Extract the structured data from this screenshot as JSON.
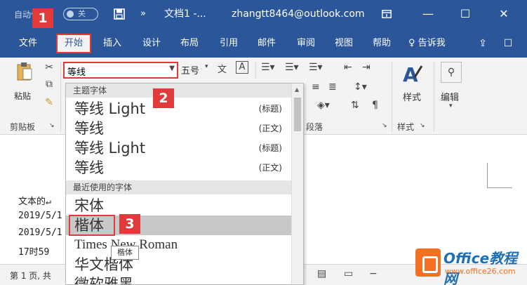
{
  "titlebar": {
    "autosave_label": "自动保存",
    "toggle_label": "关",
    "save_icon": "save-icon",
    "more_glyph": "»",
    "doc_title": "文档1 -...",
    "account": "zhangtt8464@outlook.com",
    "display_icon": "ribbon-display-icon",
    "min_glyph": "—",
    "max_glyph": "☐",
    "close_glyph": "✕"
  },
  "tabs": [
    "文件",
    "开始",
    "插入",
    "设计",
    "布局",
    "引用",
    "邮件",
    "审阅",
    "视图",
    "帮助"
  ],
  "active_tab": "开始",
  "tell_me": "告诉我",
  "ribbon": {
    "paste_label": "粘贴",
    "clipboard_label": "剪贴板",
    "font_name": "等线",
    "font_size": "五号",
    "paragraph_label": "段落",
    "styles_label": "样式",
    "styles_group_label": "样式",
    "edit_label": "编辑"
  },
  "font_dropdown": {
    "theme_header": "主题字体",
    "theme_fonts": [
      {
        "name": "等线 Light",
        "tag": "(标题)"
      },
      {
        "name": "等线",
        "tag": "(正文)"
      },
      {
        "name": "等线 Light",
        "tag": "(标题)"
      },
      {
        "name": "等线",
        "tag": "(正文)"
      }
    ],
    "recent_header": "最近使用的字体",
    "recent_fonts": [
      "宋体",
      "楷体",
      "Times New Roman",
      "华文楷体",
      "微软雅黑"
    ],
    "hovered_font": "楷体"
  },
  "tooltip": "楷体",
  "document": {
    "lines": [
      "文本的↵",
      "2019/5/1",
      "2019/5/1",
      "17时59"
    ]
  },
  "status": {
    "page_info": "第 1 页, 共"
  },
  "badges": [
    "1",
    "2",
    "3"
  ],
  "watermark": {
    "title": "Office教程网",
    "url": "www.office26.com"
  },
  "colors": {
    "word_blue": "#2b579a",
    "highlight_red": "#e03a3a",
    "ribbon_gray": "#f3f3f3"
  }
}
